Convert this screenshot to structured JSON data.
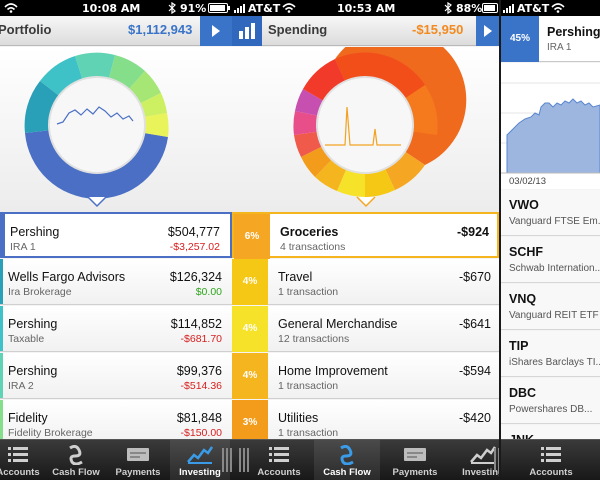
{
  "screens": {
    "portfolio": {
      "status": {
        "carrier": "",
        "time": "10:08 AM",
        "battery": "91%"
      },
      "header": {
        "title": "Portfolio",
        "amount": "$1,112,943"
      },
      "colors": {
        "accent": "#3a74c9",
        "amount": "#3a74c9"
      },
      "accounts": [
        {
          "name": "Pershing",
          "sub": "IRA 1",
          "value": "$504,777",
          "change": "-$3,257.02",
          "dir": "neg",
          "color": "#4a6fc4"
        },
        {
          "name": "Wells Fargo Advisors",
          "sub": "Ira Brokerage",
          "value": "$126,324",
          "change": "$0.00",
          "dir": "pos",
          "color": "#2a9fb8"
        },
        {
          "name": "Pershing",
          "sub": "Taxable",
          "value": "$114,852",
          "change": "-$681.70",
          "dir": "neg",
          "color": "#3ec1c7"
        },
        {
          "name": "Pershing",
          "sub": "IRA 2",
          "value": "$99,376",
          "change": "-$514.36",
          "dir": "neg",
          "color": "#5fd3b4"
        },
        {
          "name": "Fidelity",
          "sub": "Fidelity Brokerage",
          "value": "$81,848",
          "change": "-$150.00",
          "dir": "neg",
          "color": "#85de8a"
        }
      ],
      "tabs": [
        {
          "label": "Accounts",
          "icon": "list-icon"
        },
        {
          "label": "Cash Flow",
          "icon": "cashflow-icon"
        },
        {
          "label": "Payments",
          "icon": "payments-icon"
        },
        {
          "label": "Investing",
          "icon": "investing-icon",
          "active": true
        }
      ]
    },
    "spending": {
      "status": {
        "carrier": "AT&T",
        "time": "10:53 AM",
        "battery": "88%"
      },
      "header": {
        "title": "Spending",
        "amount": "-$15,950"
      },
      "colors": {
        "amount": "#f28a1f"
      },
      "categories": [
        {
          "pct": "6%",
          "name": "Groceries",
          "sub": "4 transactions",
          "value": "-$924",
          "color": "#f5a623",
          "selected": true
        },
        {
          "pct": "4%",
          "name": "Travel",
          "sub": "1 transaction",
          "value": "-$670",
          "color": "#f5c816"
        },
        {
          "pct": "4%",
          "name": "General Merchandise",
          "sub": "12 transactions",
          "value": "-$641",
          "color": "#f7e22a"
        },
        {
          "pct": "4%",
          "name": "Home Improvement",
          "sub": "1 transaction",
          "value": "-$594",
          "color": "#f5b51e"
        },
        {
          "pct": "3%",
          "name": "Utilities",
          "sub": "1 transaction",
          "value": "-$420",
          "color": "#f39c1b"
        }
      ],
      "tabs": [
        {
          "label": "Accounts",
          "icon": "list-icon"
        },
        {
          "label": "Cash Flow",
          "icon": "cashflow-icon",
          "active": true
        },
        {
          "label": "Payments",
          "icon": "payments-icon"
        },
        {
          "label": "Investing",
          "icon": "investing-icon"
        }
      ]
    },
    "holdings": {
      "status": {
        "carrier": "AT&T"
      },
      "header": {
        "pct": "45%",
        "name": "Pershing",
        "sub": "IRA 1"
      },
      "chart_date": "03/02/13",
      "stocks": [
        {
          "ticker": "VWO",
          "name": "Vanguard FTSE Em..."
        },
        {
          "ticker": "SCHF",
          "name": "Schwab Internation..."
        },
        {
          "ticker": "VNQ",
          "name": "Vanguard REIT ETF"
        },
        {
          "ticker": "TIP",
          "name": "iShares Barclays TI..."
        },
        {
          "ticker": "DBC",
          "name": "Powershares DB..."
        },
        {
          "ticker": "JNK",
          "name": ""
        }
      ],
      "tabs": [
        {
          "label": "Accounts",
          "icon": "list-icon"
        }
      ]
    }
  }
}
